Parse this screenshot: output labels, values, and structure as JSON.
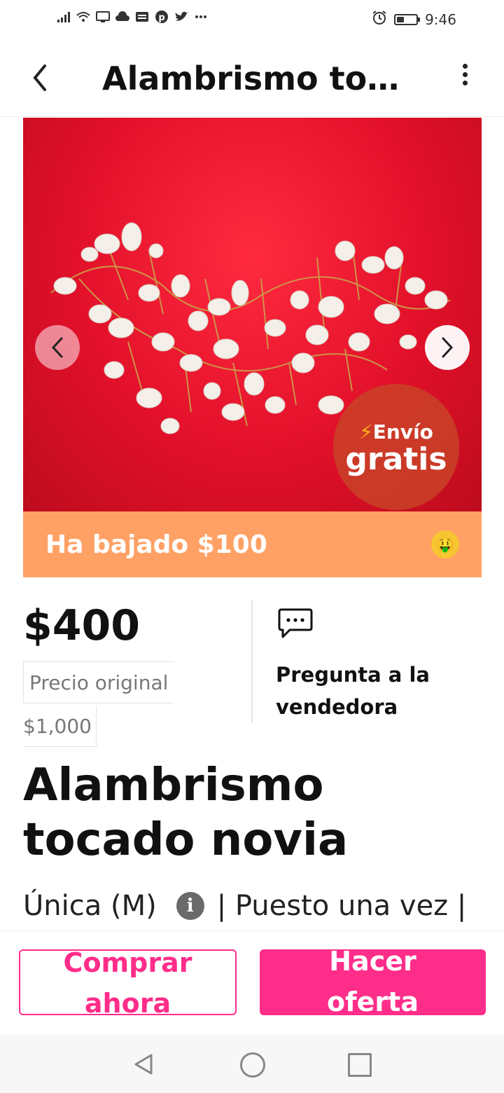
{
  "status_bar": {
    "time": "9:46",
    "icons_left": [
      "signal-icon",
      "wifi-icon",
      "screen-cast-icon",
      "cloud-icon",
      "news-icon",
      "pinterest-icon",
      "twitter-icon",
      "more-dots-icon"
    ],
    "icons_right": [
      "alarm-icon",
      "battery-icon"
    ]
  },
  "appbar": {
    "title": "Alambrismo tocado novia",
    "back_icon": "chevron-left-icon",
    "menu_icon": "more-vert-icon"
  },
  "image": {
    "description_icon": "product-photo",
    "prev_icon": "chevron-left-icon",
    "next_icon": "chevron-right-icon",
    "badge_line1": "Envío",
    "badge_line2": "gratis",
    "badge_bolt": "⚡"
  },
  "price_drop": {
    "text": "Ha bajado $100",
    "emoji": "🤑"
  },
  "pricing": {
    "price": "$400",
    "original_label": "Precio original",
    "original_value": "$1,000"
  },
  "ask_seller": {
    "label": "Pregunta a la vendedora",
    "icon": "chat-bubble-icon"
  },
  "product": {
    "title": "Alambrismo tocado novia",
    "size": "Única (M)",
    "info_icon_text": "i",
    "details_rest": "| Puesto una vez |"
  },
  "actions": {
    "buy_line1": "Comprar",
    "buy_line2": "ahora",
    "offer_line1": "Hacer",
    "offer_line2": "oferta"
  },
  "colors": {
    "accent": "#ff2d8a",
    "banner": "#ffa165",
    "image_bg": "#e2102a"
  }
}
